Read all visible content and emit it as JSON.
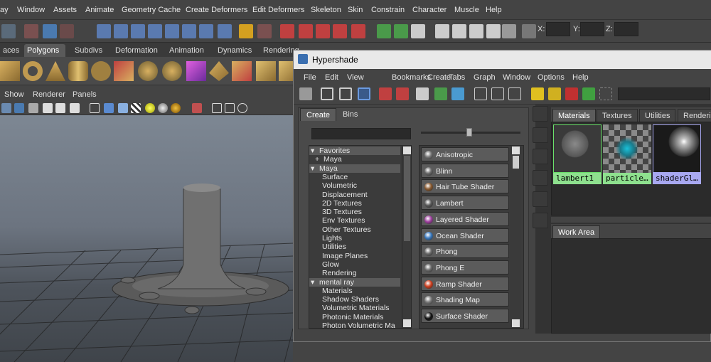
{
  "main_menu": [
    "ay",
    "Window",
    "Assets",
    "Animate",
    "Geometry Cache",
    "Create Deformers",
    "Edit Deformers",
    "Skeleton",
    "Skin",
    "Constrain",
    "Character",
    "Muscle",
    "Help"
  ],
  "status_line": {
    "x_label": "X:",
    "y_label": "Y:",
    "z_label": "Z:"
  },
  "shelf_tabs": [
    "aces",
    "Polygons",
    "Subdivs",
    "Deformation",
    "Animation",
    "Dynamics",
    "Rendering"
  ],
  "shelf_tabs_active": "Polygons",
  "panel_menu": [
    "Show",
    "Renderer",
    "Panels"
  ],
  "hypershade": {
    "title": "Hypershade",
    "menu": [
      "File",
      "Edit",
      "View",
      "Bookmarks",
      "Create",
      "Tabs",
      "Graph",
      "Window",
      "Options",
      "Help"
    ],
    "create_tabs": [
      "Create",
      "Bins"
    ],
    "create_tabs_active": "Create",
    "tree": [
      {
        "label": "Favorites",
        "level": 0,
        "header": true,
        "prefix": "▾"
      },
      {
        "label": "Maya",
        "level": 1,
        "header": false,
        "prefix": "+"
      },
      {
        "label": "Maya",
        "level": 0,
        "header": true,
        "prefix": "▾"
      },
      {
        "label": "Surface",
        "level": 2,
        "header": false,
        "prefix": ""
      },
      {
        "label": "Volumetric",
        "level": 2,
        "header": false,
        "prefix": ""
      },
      {
        "label": "Displacement",
        "level": 2,
        "header": false,
        "prefix": ""
      },
      {
        "label": "2D Textures",
        "level": 2,
        "header": false,
        "prefix": ""
      },
      {
        "label": "3D Textures",
        "level": 2,
        "header": false,
        "prefix": ""
      },
      {
        "label": "Env Textures",
        "level": 2,
        "header": false,
        "prefix": ""
      },
      {
        "label": "Other Textures",
        "level": 2,
        "header": false,
        "prefix": ""
      },
      {
        "label": "Lights",
        "level": 2,
        "header": false,
        "prefix": ""
      },
      {
        "label": "Utilities",
        "level": 2,
        "header": false,
        "prefix": ""
      },
      {
        "label": "Image Planes",
        "level": 2,
        "header": false,
        "prefix": ""
      },
      {
        "label": "Glow",
        "level": 2,
        "header": false,
        "prefix": ""
      },
      {
        "label": "Rendering",
        "level": 2,
        "header": false,
        "prefix": ""
      },
      {
        "label": "mental ray",
        "level": 0,
        "header": true,
        "prefix": "▾"
      },
      {
        "label": "Materials",
        "level": 2,
        "header": false,
        "prefix": ""
      },
      {
        "label": "Shadow Shaders",
        "level": 2,
        "header": false,
        "prefix": ""
      },
      {
        "label": "Volumetric Materials",
        "level": 2,
        "header": false,
        "prefix": ""
      },
      {
        "label": "Photonic Materials",
        "level": 2,
        "header": false,
        "prefix": ""
      },
      {
        "label": "Photon Volumetric Ma",
        "level": 2,
        "header": false,
        "prefix": ""
      }
    ],
    "shaders": [
      {
        "label": "Anisotropic",
        "color": "#777777"
      },
      {
        "label": "Blinn",
        "color": "#6a6a6a"
      },
      {
        "label": "Hair Tube Shader",
        "color": "#8a5a30"
      },
      {
        "label": "Lambert",
        "color": "#5a5a5a"
      },
      {
        "label": "Layered Shader",
        "color": "#a040a0"
      },
      {
        "label": "Ocean Shader",
        "color": "#3a7ac0"
      },
      {
        "label": "Phong",
        "color": "#6a6a6a"
      },
      {
        "label": "Phong E",
        "color": "#6a6a6a"
      },
      {
        "label": "Ramp Shader",
        "color": "#d04020"
      },
      {
        "label": "Shading Map",
        "color": "#7a7a7a"
      },
      {
        "label": "Surface Shader",
        "color": "#111111"
      }
    ],
    "material_tabs": [
      "Materials",
      "Textures",
      "Utilities",
      "Renderi"
    ],
    "material_tabs_active": "Materials",
    "swatches": [
      {
        "name": "lambert1",
        "label_color": "#8ee08e",
        "kind": "lambert"
      },
      {
        "name": "particle…",
        "label_color": "#8ee08e",
        "kind": "particle"
      },
      {
        "name": "shaderGl…",
        "label_color": "#a8a8f0",
        "kind": "glow"
      }
    ],
    "work_area_label": "Work Area"
  }
}
